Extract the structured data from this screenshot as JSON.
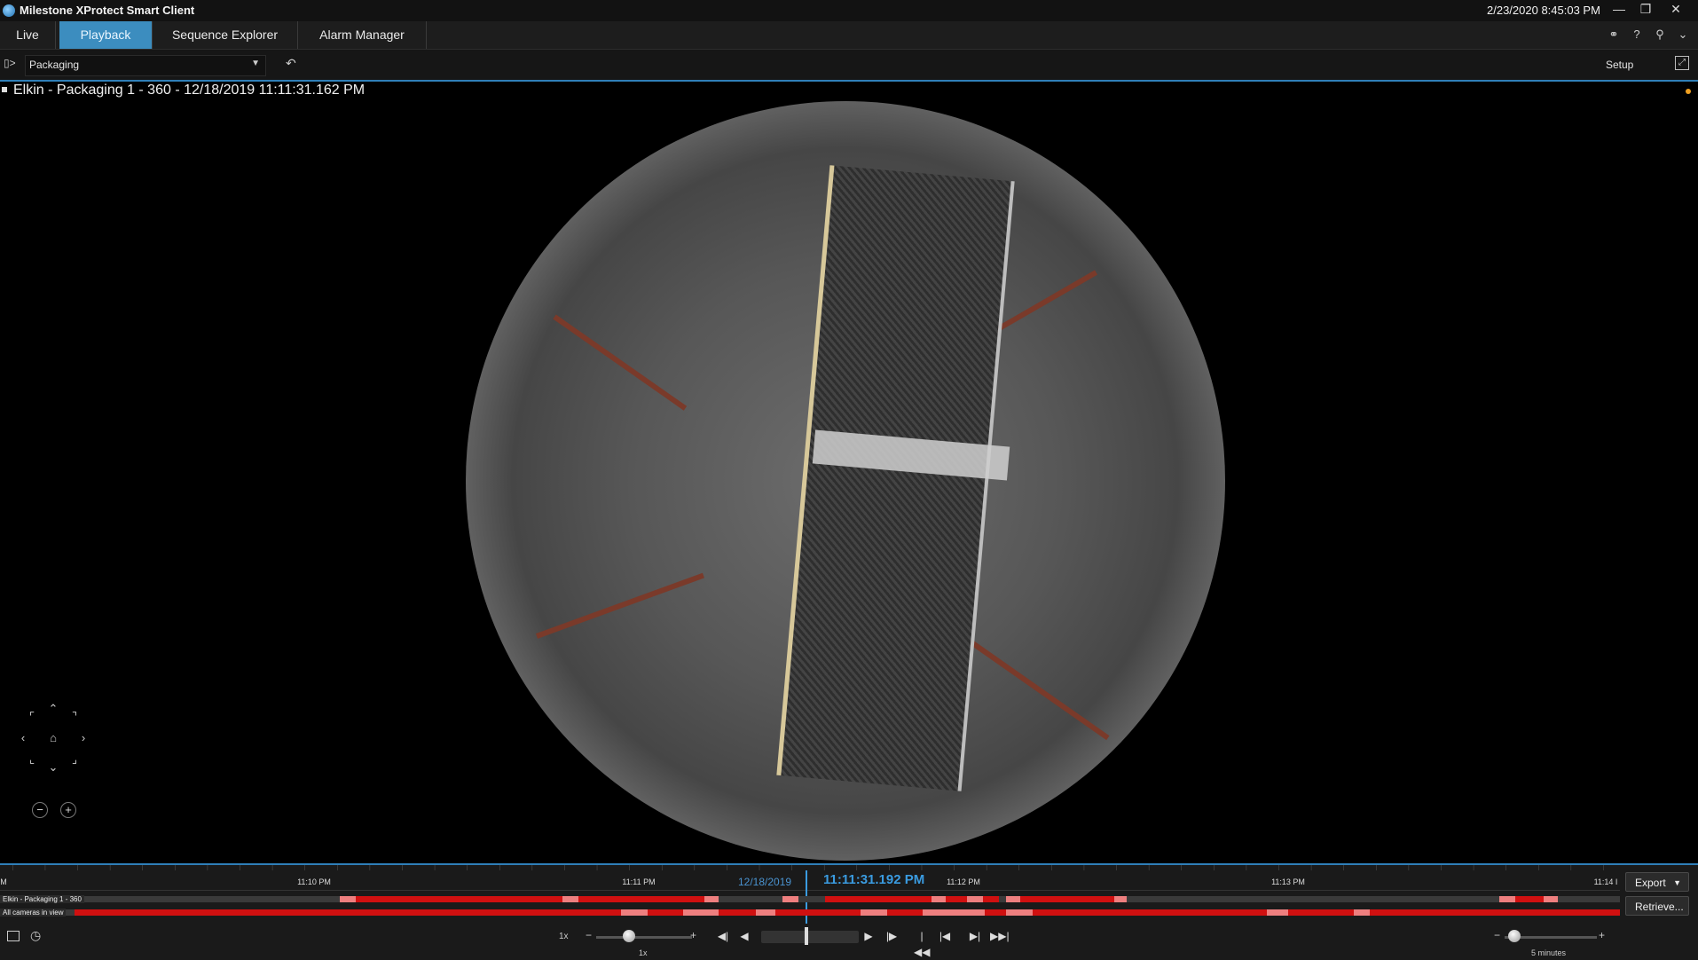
{
  "window": {
    "title": "Milestone XProtect Smart Client",
    "datetime": "2/23/2020 8:45:03 PM",
    "buttons": [
      "minimize",
      "restore",
      "close"
    ]
  },
  "tabs": [
    {
      "label": "Live",
      "active": false
    },
    {
      "label": "Playback",
      "active": true
    },
    {
      "label": "Sequence Explorer",
      "active": false
    },
    {
      "label": "Alarm Manager",
      "active": false
    }
  ],
  "header_icons": [
    "network-icon",
    "help-icon",
    "pin-icon",
    "chevron-down-icon"
  ],
  "toolbar": {
    "view_selected": "Packaging",
    "setup_label": "Setup"
  },
  "camera": {
    "title": "Elkin - Packaging 1 - 360 - 12/18/2019 11:11:31.162 PM",
    "recording_indicator_color": "#f0a020"
  },
  "ptz": {
    "icons": [
      "up-left-icon",
      "up-icon",
      "up-right-icon",
      "left-icon",
      "home-icon",
      "right-icon",
      "down-left-icon",
      "down-icon",
      "down-right-icon"
    ],
    "zoom_out": "−",
    "zoom_in": "+"
  },
  "timeline": {
    "tick_labels": [
      "M",
      "11:10 PM",
      "11:11 PM",
      "11:12 PM",
      "11:13 PM",
      "11:14 I"
    ],
    "current_date": "12/18/2019",
    "current_time": "11:11:31.192 PM",
    "tracks": [
      {
        "label": "Elkin - Packaging 1 - 360"
      },
      {
        "label": "All cameras in view"
      }
    ],
    "export_label": "Export",
    "retrieve_label": "Retrieve...",
    "speed_label": "1x",
    "speed_value": "1x",
    "timespan_label": "5 minutes",
    "slider_minus": "−",
    "slider_plus": "+"
  },
  "colors": {
    "accent": "#3c8dbf",
    "motion": "#d01010",
    "recording": "#ee7f7f"
  }
}
